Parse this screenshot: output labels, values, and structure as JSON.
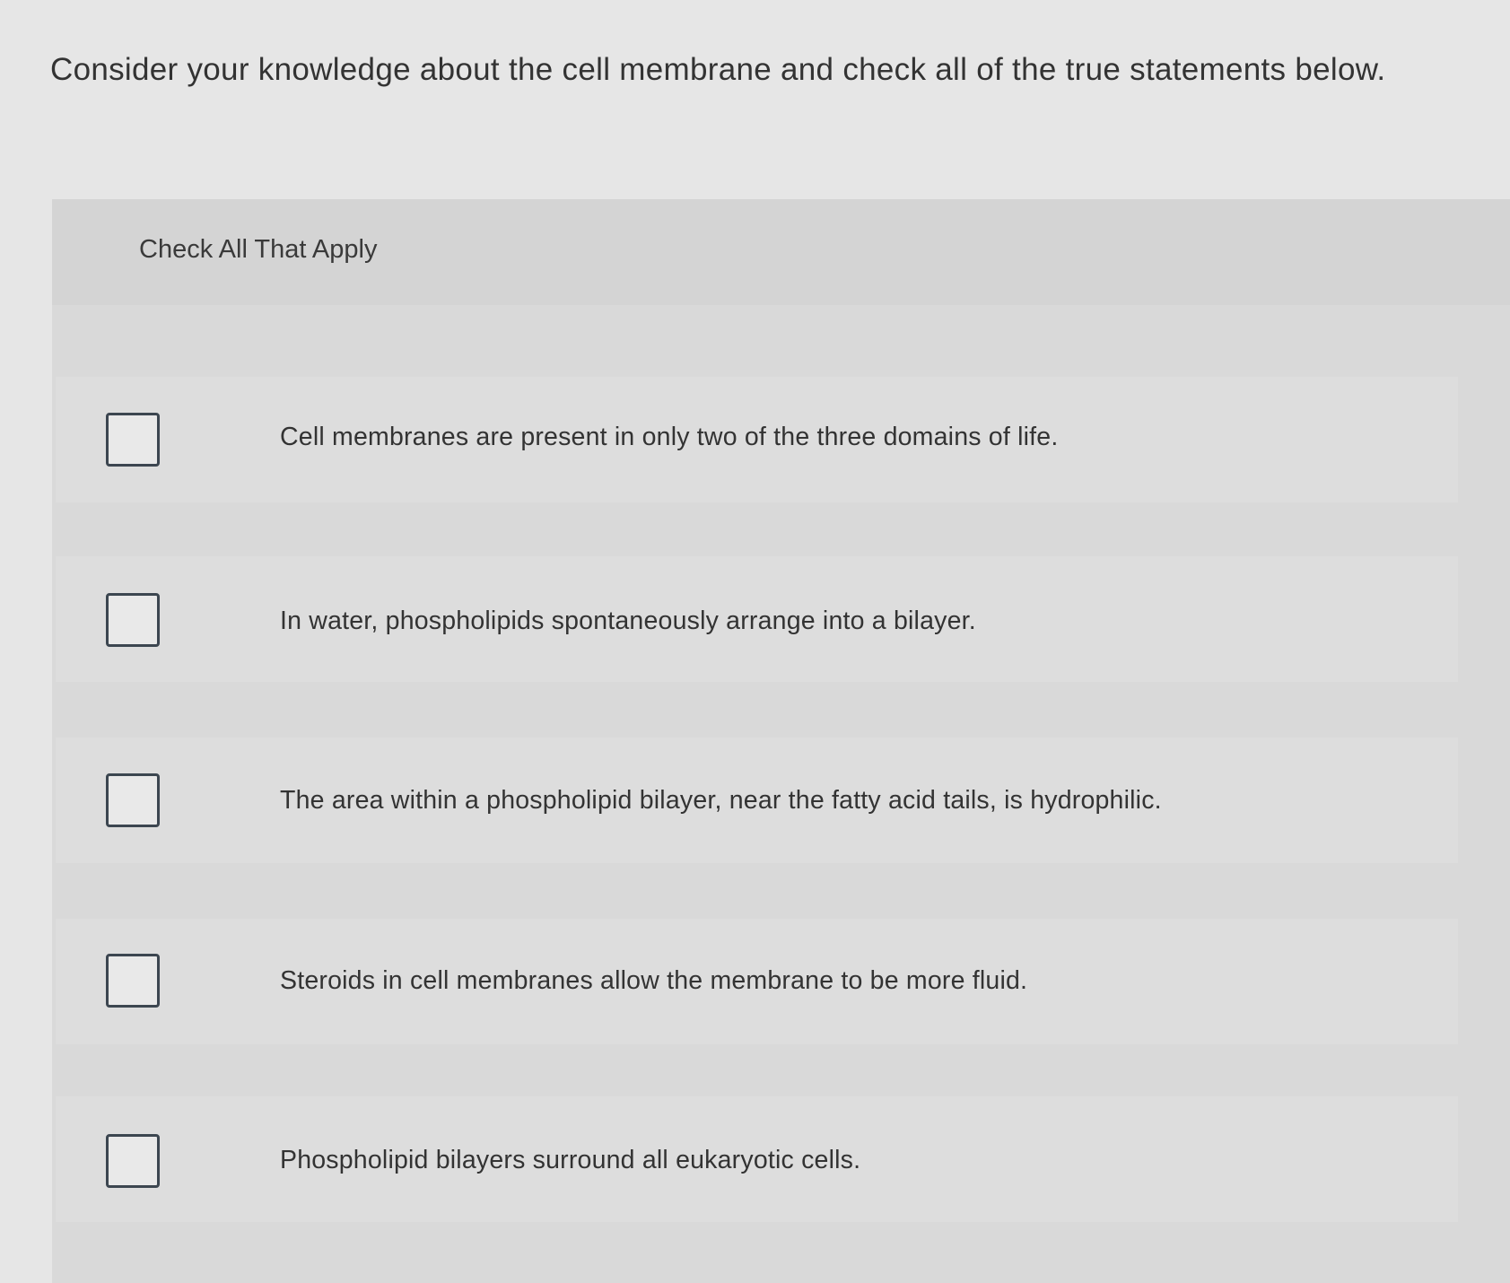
{
  "question": {
    "prompt": "Consider your knowledge about the cell membrane and check all of the true statements below."
  },
  "answer_panel": {
    "instruction": "Check All That Apply",
    "options": [
      {
        "label": "Cell membranes are present in only two of the three domains of life.",
        "checked": false
      },
      {
        "label": "In water, phospholipids spontaneously arrange into a bilayer.",
        "checked": false
      },
      {
        "label": "The area within a phospholipid bilayer, near the fatty acid tails, is hydrophilic.",
        "checked": false
      },
      {
        "label": "Steroids in cell membranes allow the membrane to be more fluid.",
        "checked": false
      },
      {
        "label": "Phospholipid bilayers surround all eukaryotic cells.",
        "checked": false
      }
    ]
  },
  "colors": {
    "page_background": "#e6e6e6",
    "panel_background": "#d9d9d9",
    "checkbox_border": "#3c4650",
    "text": "#333333"
  }
}
